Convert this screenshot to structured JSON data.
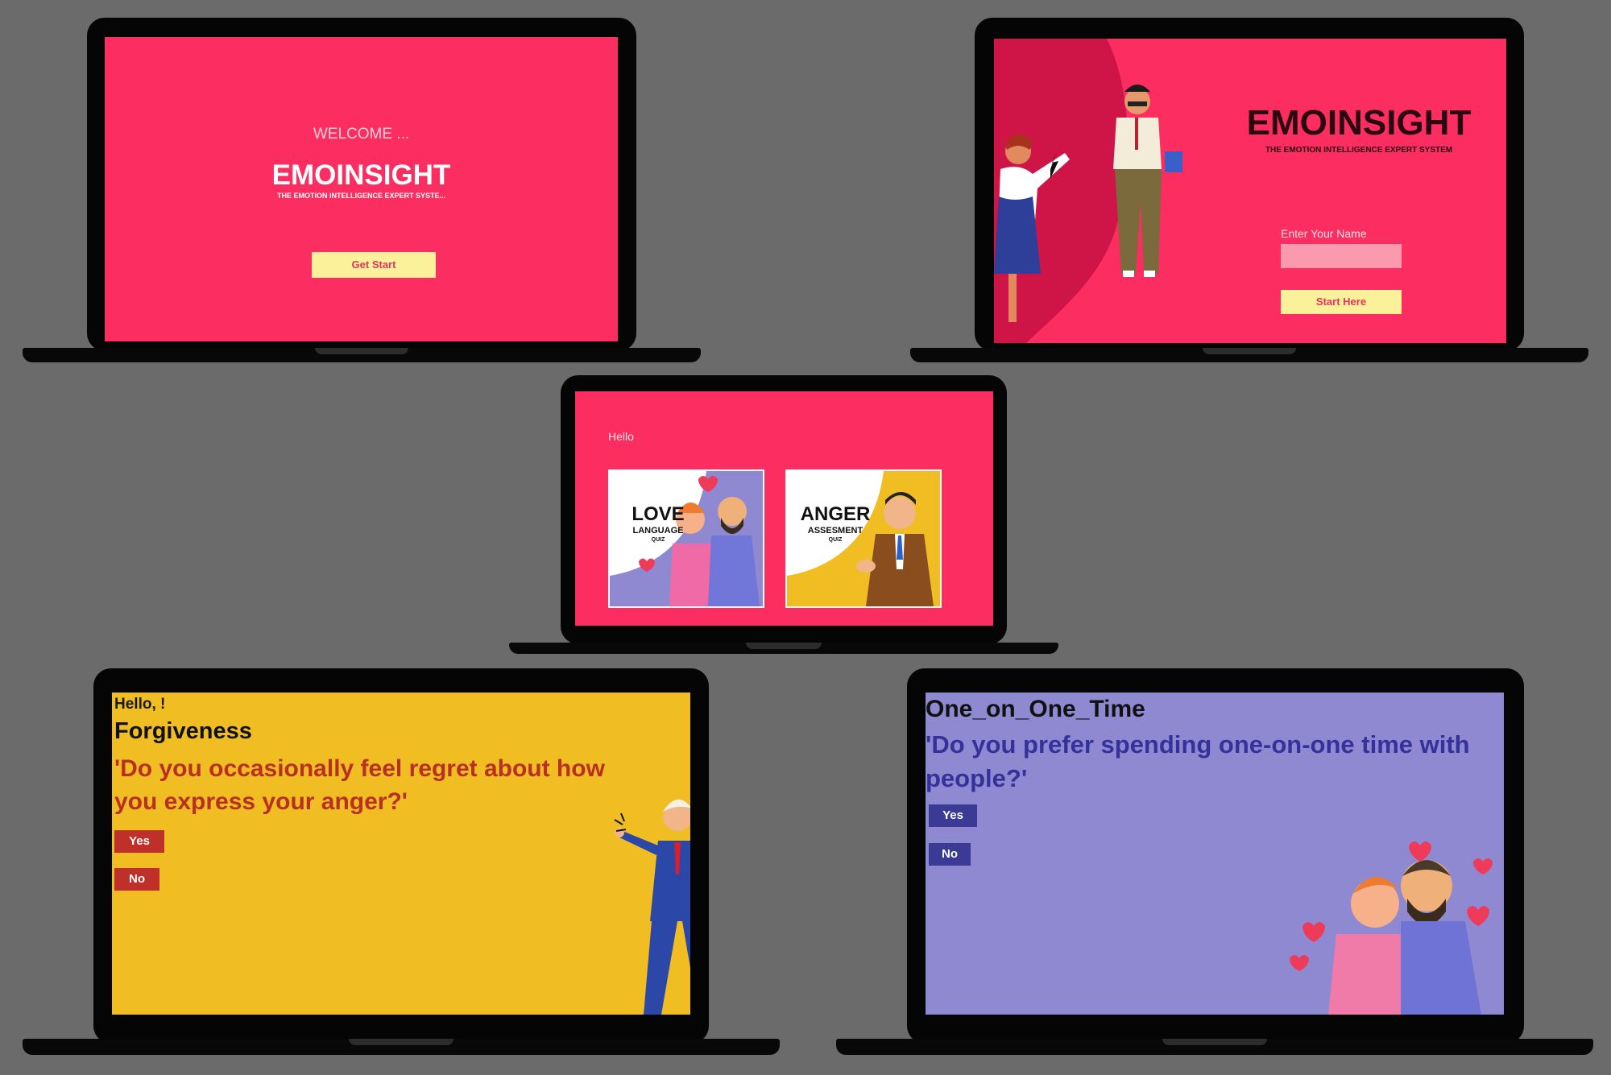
{
  "colors": {
    "pink": "#fc2d60",
    "yellow": "#f0be22",
    "lavender": "#8f89d1",
    "button_yellow": "#fbf19a",
    "dark_red": "#c0302a",
    "navy_button": "#3b3a95"
  },
  "welcome": {
    "greeting": "WELCOME ...",
    "title": "EMOINSIGHT",
    "subtitle": "THE EMOTION INTELLIGENCE EXPERT SYSTE...",
    "button": "Get Start"
  },
  "login": {
    "title": "EMOINSIGHT",
    "subtitle": "THE EMOTION INTELLIGENCE EXPERT SYSTEM",
    "name_label": "Enter Your Name",
    "name_value": "",
    "button": "Start Here"
  },
  "quiz_select": {
    "greeting": "Hello",
    "cards": [
      {
        "big": "LOVE",
        "mid": "LANGUAGE",
        "small": "QUIZ",
        "icon": "couple-illustration"
      },
      {
        "big": "ANGER",
        "mid": "ASSESMENT",
        "small": "QUIZ",
        "icon": "angry-man-illustration"
      }
    ]
  },
  "anger_quiz": {
    "greeting": "Hello, !",
    "category": "Forgiveness",
    "question": "'Do you occasionally feel regret about how you express your anger?'",
    "yes": "Yes",
    "no": "No"
  },
  "love_quiz": {
    "category": "One_on_One_Time",
    "question": "'Do you prefer spending one-on-one time with people?'",
    "yes": "Yes",
    "no": "No"
  }
}
